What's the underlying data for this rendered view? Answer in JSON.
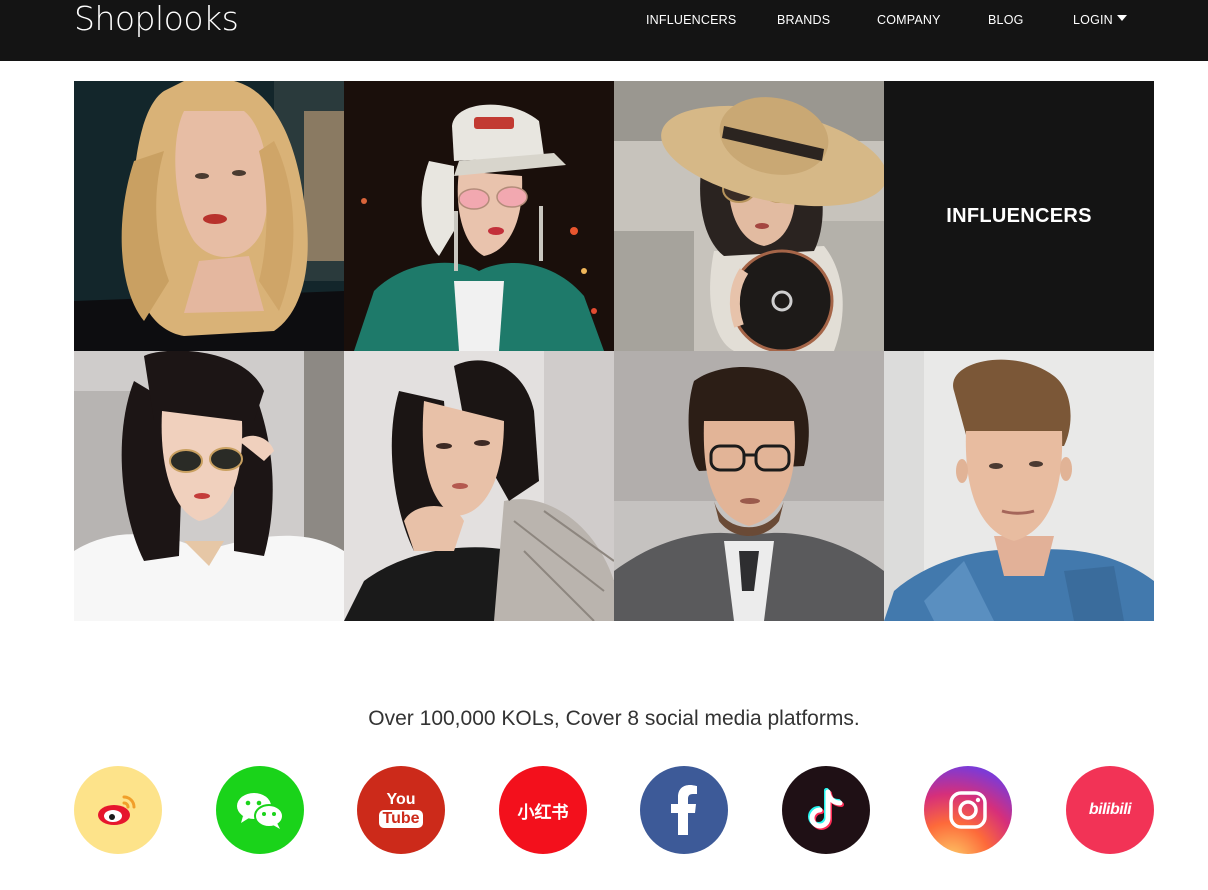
{
  "header": {
    "logo": "Shoplooks",
    "nav": {
      "influencers": "INFLUENCERS",
      "brands": "BRANDS",
      "company": "COMPANY",
      "blog": "BLOG",
      "login": "LOGIN"
    }
  },
  "grid": {
    "title": "INFLUENCERS"
  },
  "tagline": "Over 100,000 KOLs, Cover 8 social media platforms.",
  "platforms": {
    "youtube_top": "You",
    "youtube_bottom": "Tube",
    "xiaohongshu": "小红书",
    "bilibili": "bilibili"
  },
  "colors": {
    "header_bg": "#141414",
    "weibo": "#fde38a",
    "wechat": "#1ad31a",
    "youtube": "#cc2a1a",
    "xiaohongshu": "#f3101c",
    "facebook": "#3d5a98",
    "tiktok": "#1f1015",
    "bilibili": "#f23356"
  }
}
